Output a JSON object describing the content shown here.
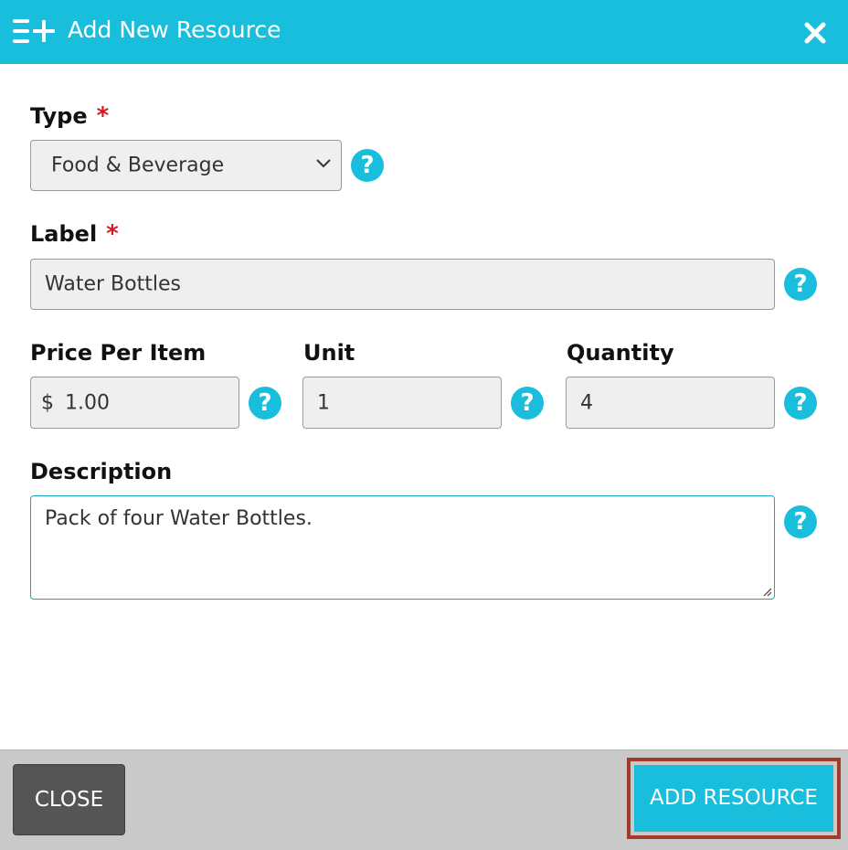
{
  "dialog": {
    "title": "Add New Resource",
    "header_icon": "add-list-icon",
    "close_icon": "close-icon",
    "accent_color": "#18bedc",
    "highlight_color": "#a23a2c"
  },
  "form": {
    "type": {
      "label": "Type",
      "required_mark": "*",
      "value": "Food & Beverage"
    },
    "label_field": {
      "label": "Label",
      "required_mark": "*",
      "value": "Water Bottles"
    },
    "price": {
      "label": "Price Per Item",
      "prefix": "$",
      "value": "1.00"
    },
    "unit": {
      "label": "Unit",
      "value": "1"
    },
    "quantity": {
      "label": "Quantity",
      "value": "4"
    },
    "description": {
      "label": "Description",
      "value": "Pack of four Water Bottles."
    },
    "help_glyph": "?"
  },
  "footer": {
    "close_label": "CLOSE",
    "add_label": "ADD RESOURCE"
  }
}
